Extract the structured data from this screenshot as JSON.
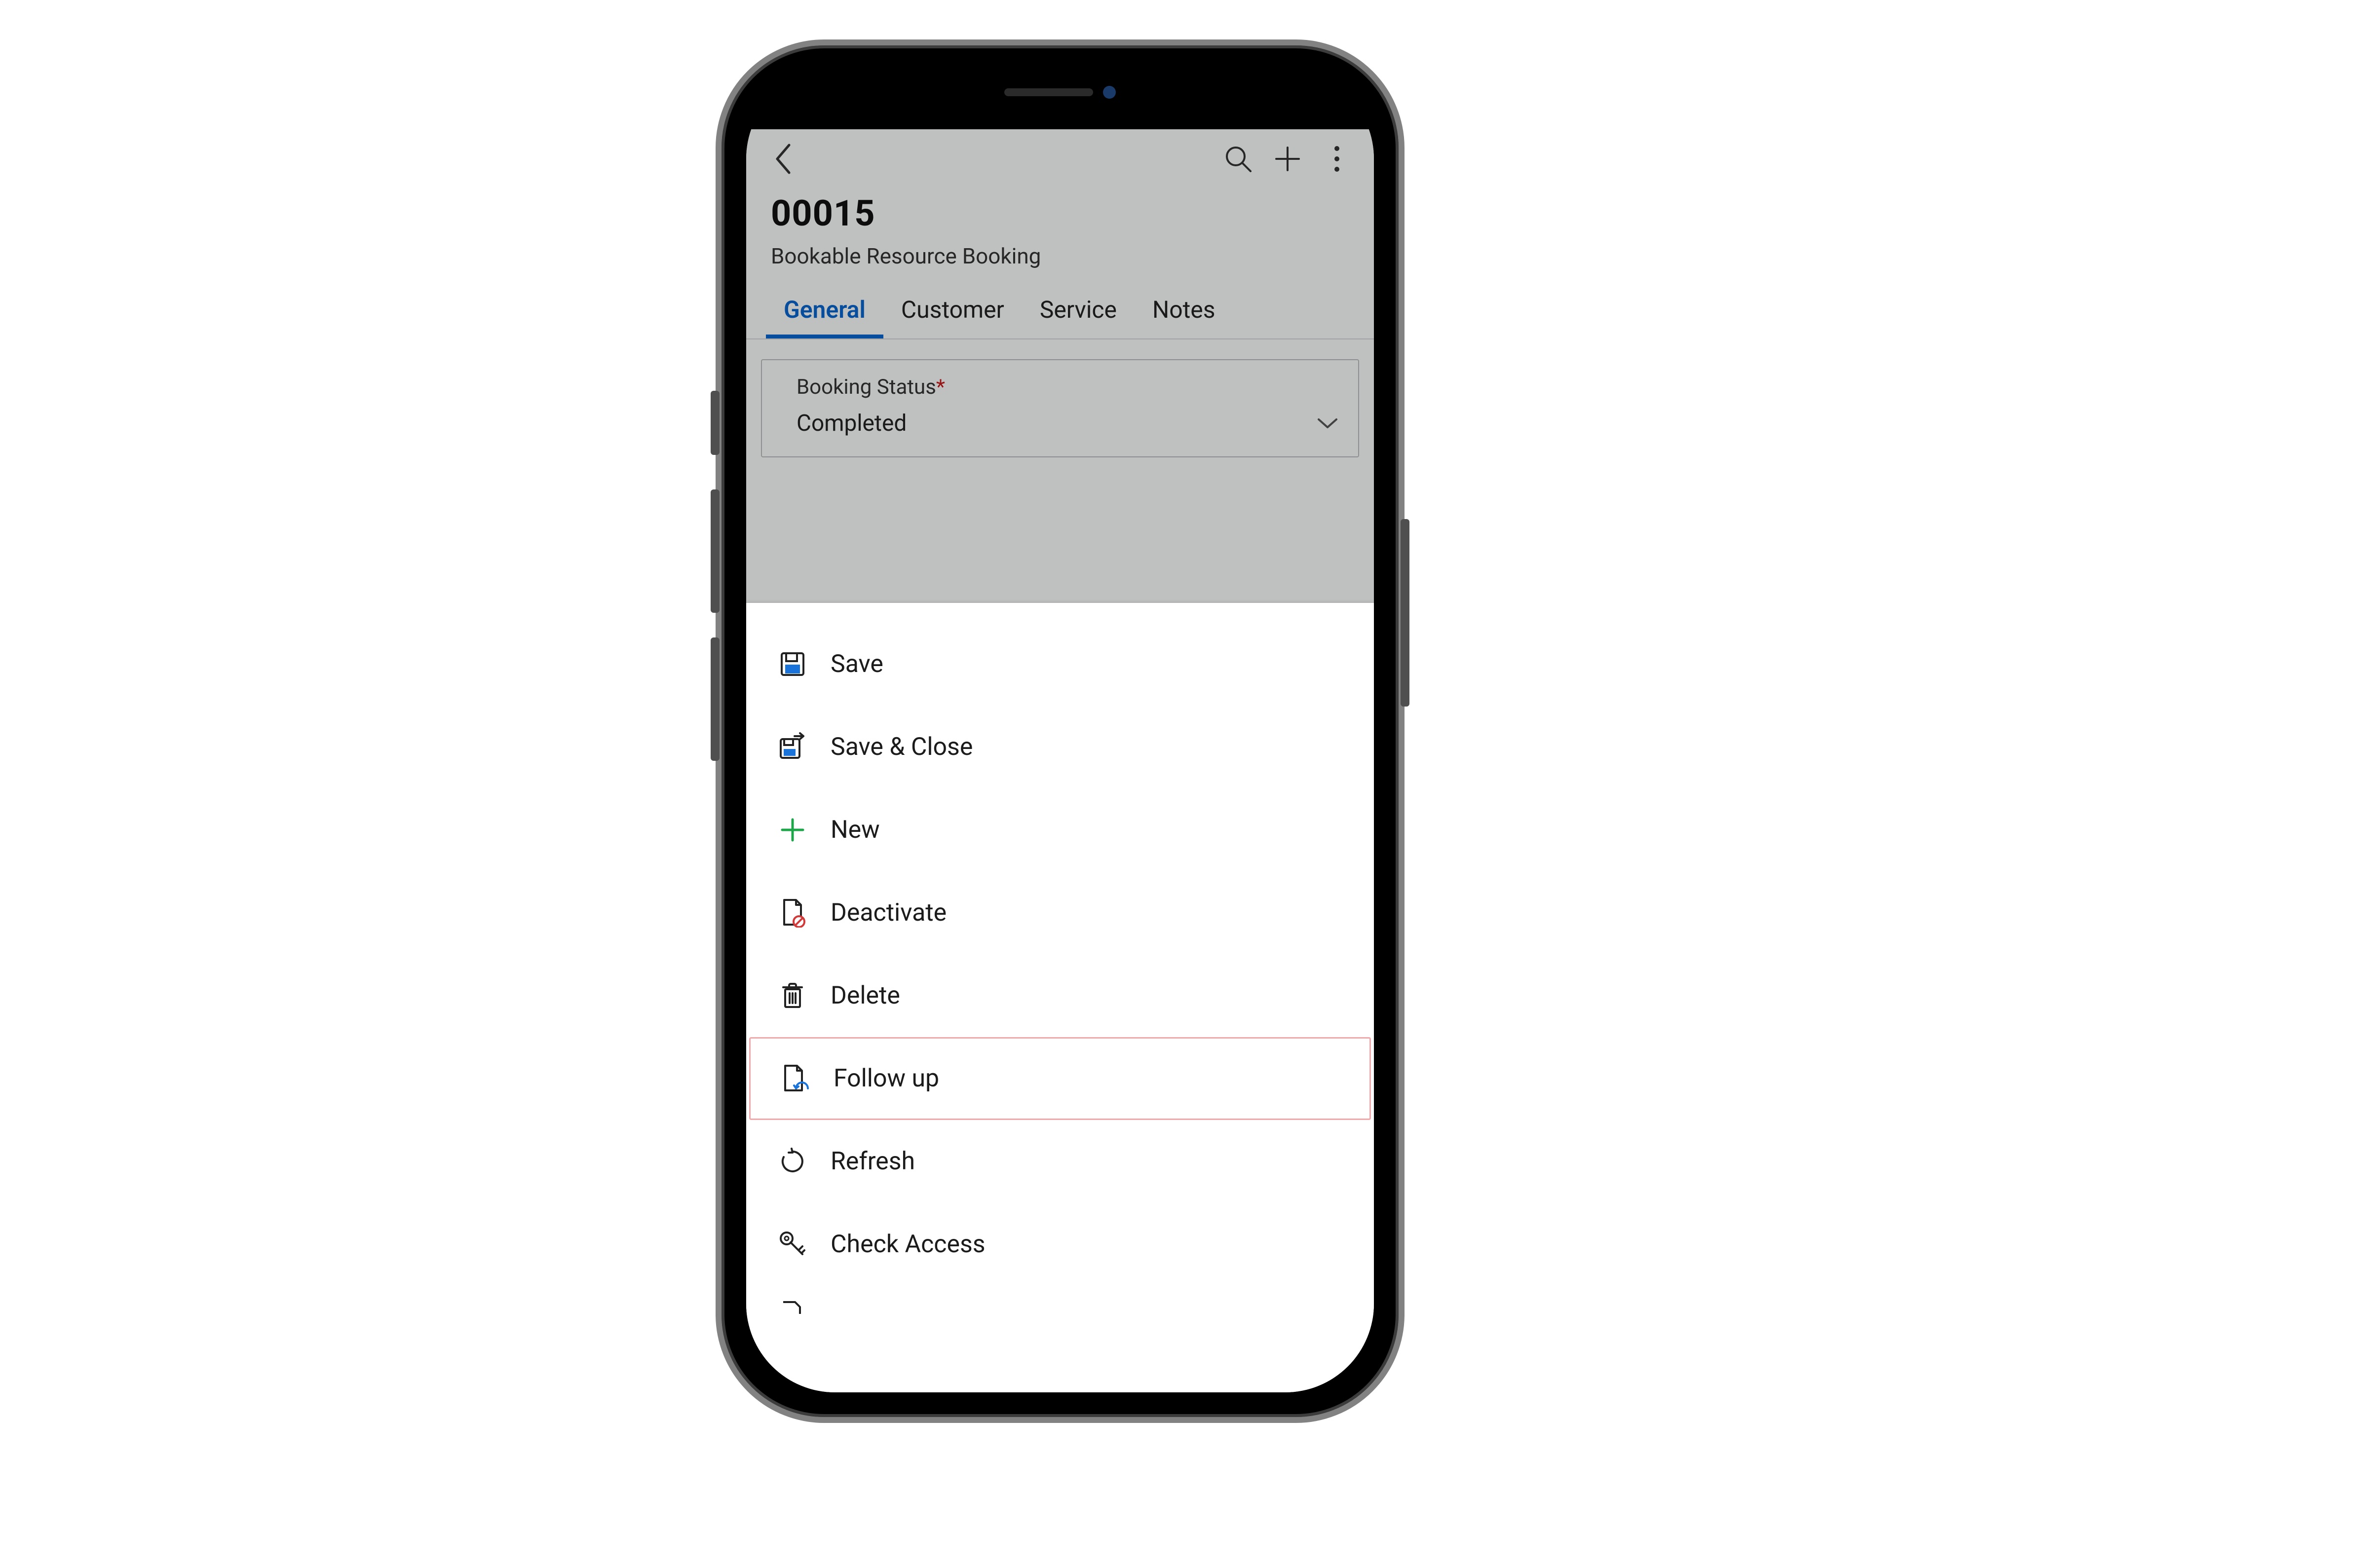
{
  "header": {
    "title": "00015",
    "subtitle": "Bookable Resource Booking"
  },
  "tabs": {
    "items": [
      {
        "label": "General",
        "active": true
      },
      {
        "label": "Customer",
        "active": false
      },
      {
        "label": "Service",
        "active": false
      },
      {
        "label": "Notes",
        "active": false
      }
    ]
  },
  "form": {
    "booking_status_label": "Booking Status",
    "booking_status_required_marker": "*",
    "booking_status_value": "Completed"
  },
  "action_sheet": {
    "items": [
      {
        "id": "save",
        "label": "Save",
        "icon": "save-icon",
        "highlight": false
      },
      {
        "id": "save-close",
        "label": "Save & Close",
        "icon": "save-close-icon",
        "highlight": false
      },
      {
        "id": "new",
        "label": "New",
        "icon": "plus-icon",
        "highlight": false
      },
      {
        "id": "deactivate",
        "label": "Deactivate",
        "icon": "deactivate-icon",
        "highlight": false
      },
      {
        "id": "delete",
        "label": "Delete",
        "icon": "trash-icon",
        "highlight": false
      },
      {
        "id": "follow-up",
        "label": "Follow up",
        "icon": "followup-icon",
        "highlight": true
      },
      {
        "id": "refresh",
        "label": "Refresh",
        "icon": "refresh-icon",
        "highlight": false
      },
      {
        "id": "check-access",
        "label": "Check Access",
        "icon": "key-icon",
        "highlight": false
      }
    ]
  },
  "icons": {
    "back-icon": "back",
    "search-icon": "search",
    "add-icon": "add",
    "more-icon": "more"
  }
}
